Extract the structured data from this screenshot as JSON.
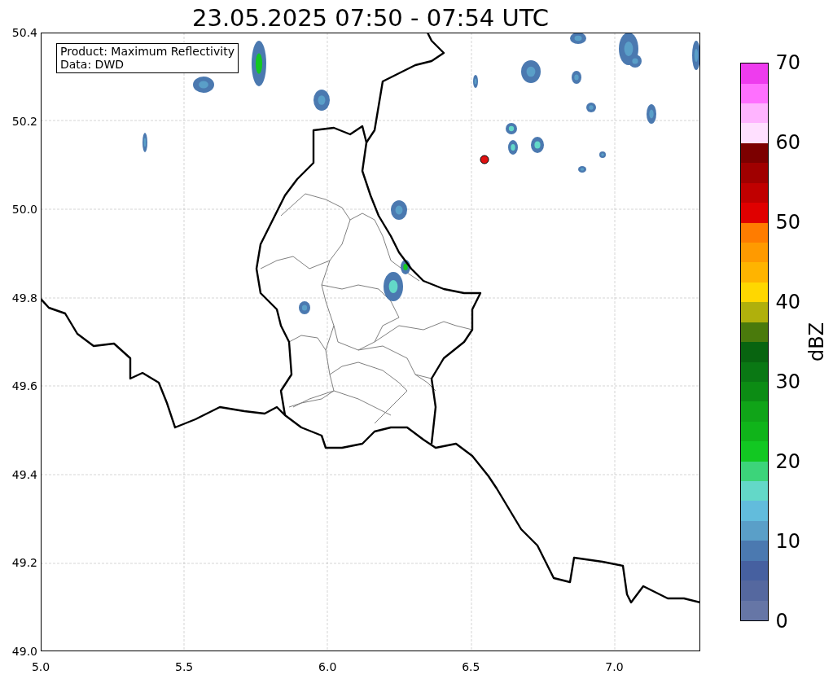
{
  "title": "23.05.2025 07:50 - 07:54 UTC",
  "annotation": {
    "lines": [
      "Product: Maximum Reflectivity",
      "Data: DWD"
    ]
  },
  "map": {
    "xticks": [
      "5.0",
      "5.5",
      "6.0",
      "6.5",
      "7.0"
    ],
    "yticks": [
      "50.4",
      "50.2",
      "50.0",
      "49.8",
      "49.6",
      "49.4",
      "49.2",
      "49.0"
    ]
  },
  "colorbar": {
    "label": "dBZ",
    "ticks": [
      "70",
      "60",
      "50",
      "40",
      "30",
      "20",
      "10",
      "0"
    ],
    "bins": [
      {
        "color": "#6676a6"
      },
      {
        "color": "#55689f"
      },
      {
        "color": "#4660a0"
      },
      {
        "color": "#4b79b0"
      },
      {
        "color": "#5a9fc8"
      },
      {
        "color": "#62bcdc"
      },
      {
        "color": "#63d8c8"
      },
      {
        "color": "#3cd47a"
      },
      {
        "color": "#12c822"
      },
      {
        "color": "#10b41a"
      },
      {
        "color": "#10a418"
      },
      {
        "color": "#0c8c14"
      },
      {
        "color": "#0a7814"
      },
      {
        "color": "#086410"
      },
      {
        "color": "#4a7a0c"
      },
      {
        "color": "#b0b00c"
      },
      {
        "color": "#ffd700"
      },
      {
        "color": "#ffb400"
      },
      {
        "color": "#ff9a00"
      },
      {
        "color": "#ff7c00"
      },
      {
        "color": "#e00000"
      },
      {
        "color": "#c00000"
      },
      {
        "color": "#a00000"
      },
      {
        "color": "#7c0000"
      },
      {
        "color": "#ffe0ff"
      },
      {
        "color": "#ffb4ff"
      },
      {
        "color": "#ff70ff"
      },
      {
        "color": "#ee3cee"
      }
    ]
  }
}
